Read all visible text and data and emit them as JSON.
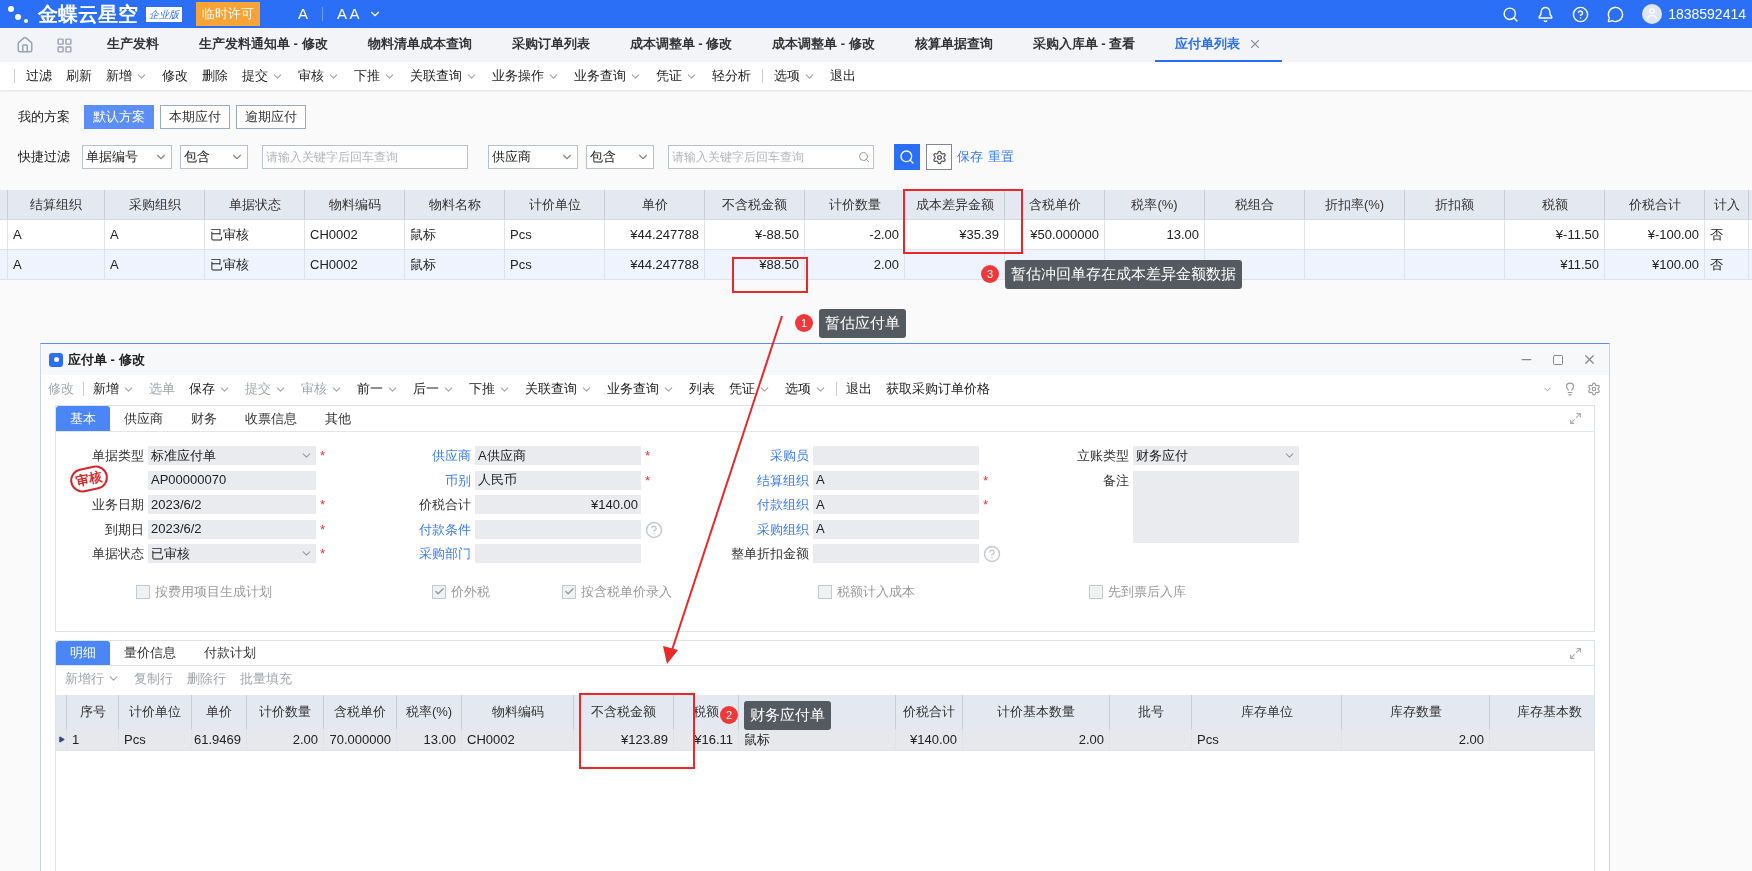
{
  "top_bar": {
    "logo_text": "金蝶云星空",
    "edition": "企业版",
    "license_badge": "临时许可",
    "font_small": "A",
    "font_large": "A A",
    "user": "1838592414"
  },
  "tabs": [
    {
      "label": "生产发料",
      "selected": false,
      "closable": false
    },
    {
      "label": "生产发料通知单 - 修改",
      "selected": false,
      "closable": false
    },
    {
      "label": "物料清单成本查询",
      "selected": false,
      "closable": false
    },
    {
      "label": "采购订单列表",
      "selected": false,
      "closable": false
    },
    {
      "label": "成本调整单 - 修改",
      "selected": false,
      "closable": false
    },
    {
      "label": "成本调整单 - 修改",
      "selected": false,
      "closable": false
    },
    {
      "label": "核算单据查询",
      "selected": false,
      "closable": false
    },
    {
      "label": "采购入库单 - 查看",
      "selected": false,
      "closable": false
    },
    {
      "label": "应付单列表",
      "selected": true,
      "closable": true
    }
  ],
  "toolbar": {
    "groups": [
      [
        {
          "label": "过滤",
          "menu": false
        },
        {
          "label": "刷新",
          "menu": false
        },
        {
          "label": "新增",
          "menu": true
        },
        {
          "label": "修改",
          "menu": false
        },
        {
          "label": "删除",
          "menu": false
        },
        {
          "label": "提交",
          "menu": true
        },
        {
          "label": "审核",
          "menu": true
        },
        {
          "label": "下推",
          "menu": true
        },
        {
          "label": "关联查询",
          "menu": true
        },
        {
          "label": "业务操作",
          "menu": true
        },
        {
          "label": "业务查询",
          "menu": true
        },
        {
          "label": "凭证",
          "menu": true
        },
        {
          "label": "轻分析",
          "menu": false
        }
      ],
      [
        {
          "label": "选项",
          "menu": true
        },
        {
          "label": "退出",
          "menu": false
        }
      ]
    ]
  },
  "filter": {
    "scheme_label": "我的方案",
    "schemes": [
      {
        "label": "默认方案",
        "selected": true
      },
      {
        "label": "本期应付",
        "selected": false
      },
      {
        "label": "逾期应付",
        "selected": false
      }
    ],
    "quick_label": "快捷过滤",
    "conditions": [
      {
        "field": "单据编号",
        "operator": "包含",
        "placeholder": "请输入关键字后回车查询"
      },
      {
        "field": "供应商",
        "operator": "包含",
        "placeholder": "请输入关键字后回车查询"
      }
    ],
    "links": [
      "保存",
      "重置"
    ]
  },
  "list_grid": {
    "columns": [
      {
        "label": "结算组织",
        "numeric": false
      },
      {
        "label": "采购组织",
        "numeric": false
      },
      {
        "label": "单据状态",
        "numeric": false
      },
      {
        "label": "物料编码",
        "numeric": false
      },
      {
        "label": "物料名称",
        "numeric": false
      },
      {
        "label": "计价单位",
        "numeric": false
      },
      {
        "label": "单价",
        "numeric": true
      },
      {
        "label": "不含税金额",
        "numeric": true
      },
      {
        "label": "计价数量",
        "numeric": true
      },
      {
        "label": "成本差异金额",
        "numeric": true
      },
      {
        "label": "含税单价",
        "numeric": true
      },
      {
        "label": "税率(%)",
        "numeric": true
      },
      {
        "label": "税组合"
      },
      {
        "label": "折扣率(%)"
      },
      {
        "label": "折扣额"
      },
      {
        "label": "税额",
        "numeric": true
      },
      {
        "label": "价税合计",
        "numeric": true
      },
      {
        "label": "计入",
        "numeric": false
      }
    ],
    "rows": [
      {
        "selected": false,
        "cells": [
          "A",
          "A",
          "已审核",
          "CH0002",
          "鼠标",
          "Pcs",
          "¥44.247788",
          "¥-88.50",
          "-2.00",
          "¥35.39",
          "¥50.000000",
          "13.00",
          null,
          null,
          null,
          "¥-11.50",
          "¥-100.00",
          "否"
        ]
      },
      {
        "selected": true,
        "cells": [
          "A",
          "A",
          "已审核",
          "CH0002",
          "鼠标",
          "Pcs",
          "¥44.247788",
          "¥88.50",
          "2.00",
          null,
          null,
          null,
          null,
          null,
          null,
          "¥11.50",
          "¥100.00",
          "否"
        ]
      }
    ]
  },
  "callouts": [
    {
      "number": "1",
      "text": "暂估应付单"
    },
    {
      "number": "2",
      "text": "财务应付单"
    },
    {
      "number": "3",
      "text": "暂估冲回单存在成本差异金额数据"
    }
  ],
  "dialog": {
    "title": "应付单 - 修改",
    "required_mark": "*",
    "toolbar": [
      [
        {
          "label": "修改",
          "menu": false,
          "disabled": true
        }
      ],
      [
        {
          "label": "新增",
          "menu": true,
          "disabled": false
        },
        {
          "label": "选单",
          "menu": false,
          "disabled": true
        },
        {
          "label": "保存",
          "menu": true,
          "disabled": false
        },
        {
          "label": "提交",
          "menu": true,
          "disabled": true
        },
        {
          "label": "审核",
          "menu": true,
          "disabled": true
        },
        {
          "label": "前一",
          "menu": true,
          "disabled": false
        },
        {
          "label": "后一",
          "menu": true,
          "disabled": false
        },
        {
          "label": "下推",
          "menu": true,
          "disabled": false
        },
        {
          "label": "关联查询",
          "menu": true,
          "disabled": false
        },
        {
          "label": "业务查询",
          "menu": true,
          "disabled": false
        },
        {
          "label": "列表",
          "menu": false,
          "disabled": false
        },
        {
          "label": "凭证",
          "menu": true,
          "disabled": false
        },
        {
          "label": "选项",
          "menu": true,
          "disabled": false
        }
      ],
      [
        {
          "label": "退出",
          "menu": false,
          "disabled": false
        },
        {
          "label": "获取采购订单价格",
          "menu": false,
          "disabled": false
        }
      ]
    ],
    "tabs": [
      {
        "label": "基本",
        "selected": true
      },
      {
        "label": "供应商",
        "selected": false
      },
      {
        "label": "财务",
        "selected": false
      },
      {
        "label": "收票信息",
        "selected": false
      },
      {
        "label": "其他",
        "selected": false
      }
    ],
    "form": [
      [
        {
          "label": "单据类型",
          "value": "标准应付单",
          "kind": "select",
          "link": false,
          "required": true,
          "help": false
        },
        {
          "stamp": "审核",
          "value": "AP00000070",
          "kind": "text",
          "required": false,
          "help": false
        },
        {
          "label": "业务日期",
          "value": "2023/6/2",
          "kind": "text",
          "link": false,
          "required": true,
          "help": false
        },
        {
          "label": "到期日",
          "value": "2023/6/2",
          "kind": "text",
          "link": false,
          "required": true,
          "help": false
        },
        {
          "label": "单据状态",
          "value": "已审核",
          "kind": "select",
          "link": false,
          "required": true,
          "help": false
        }
      ],
      [
        {
          "label": "供应商",
          "value": "A供应商",
          "kind": "text",
          "link": true,
          "required": true,
          "help": false
        },
        {
          "label": "币别",
          "value": "人民币",
          "kind": "text",
          "link": true,
          "required": true,
          "help": false
        },
        {
          "label": "价税合计",
          "value": "¥140.00",
          "kind": "amount",
          "link": false,
          "required": false,
          "help": false
        },
        {
          "label": "付款条件",
          "kind": "text",
          "link": true,
          "required": false,
          "help": true
        },
        {
          "label": "采购部门",
          "kind": "text",
          "link": true,
          "required": false,
          "help": false
        }
      ],
      [
        {
          "label": "采购员",
          "kind": "text",
          "link": true,
          "required": false,
          "help": false
        },
        {
          "label": "结算组织",
          "value": "A",
          "kind": "text",
          "link": true,
          "required": true,
          "help": false
        },
        {
          "label": "付款组织",
          "value": "A",
          "kind": "text",
          "link": true,
          "required": true,
          "help": false
        },
        {
          "label": "采购组织",
          "value": "A",
          "kind": "text",
          "link": true,
          "required": false,
          "help": false
        },
        {
          "label": "整单折扣金额",
          "kind": "text",
          "link": false,
          "required": false,
          "help": true
        }
      ],
      [
        {
          "label": "立账类型",
          "value": "财务应付",
          "kind": "select",
          "link": false,
          "required": false,
          "help": false
        },
        {
          "label": "备注",
          "kind": "textarea",
          "link": false,
          "required": false,
          "help": false
        }
      ]
    ],
    "checkboxes": [
      {
        "label": "按费用项目生成计划",
        "checked": false,
        "disabled": true
      },
      {
        "label": "价外税",
        "checked": true,
        "disabled": true
      },
      {
        "label": "按含税单价录入",
        "checked": true,
        "disabled": true
      },
      {
        "label": "税额计入成本",
        "checked": false,
        "disabled": true
      },
      {
        "label": "先到票后入库",
        "checked": false,
        "disabled": true
      }
    ],
    "detail_tabs": [
      {
        "label": "明细",
        "selected": true
      },
      {
        "label": "量价信息",
        "selected": false
      },
      {
        "label": "付款计划",
        "selected": false
      }
    ],
    "detail_toolbar": [
      {
        "label": "新增行",
        "menu": true,
        "disabled": true
      },
      {
        "label": "复制行",
        "menu": false,
        "disabled": true
      },
      {
        "label": "删除行",
        "menu": false,
        "disabled": true
      },
      {
        "label": "批量填充",
        "menu": false,
        "disabled": true
      }
    ],
    "detail_grid": {
      "columns": [
        {
          "label": "序号",
          "numeric": false
        },
        {
          "label": "计价单位",
          "numeric": false
        },
        {
          "label": "单价",
          "numeric": true
        },
        {
          "label": "计价数量",
          "numeric": true
        },
        {
          "label": "含税单价",
          "numeric": true
        },
        {
          "label": "税率(%)",
          "numeric": true
        },
        {
          "label": "物料编码",
          "numeric": false
        },
        {
          "label": "不含税金额",
          "numeric": true
        },
        {
          "label": "税额",
          "numeric": true
        },
        {
          "numeric": false
        },
        {
          "label": "价税合计",
          "numeric": true
        },
        {
          "label": "计价基本数量",
          "numeric": true
        },
        {
          "label": "批号"
        },
        {
          "label": "库存单位",
          "numeric": false
        },
        {
          "label": "库存数量",
          "numeric": true
        },
        {
          "label": "库存基本数"
        }
      ],
      "rows": [
        {
          "selected": true,
          "cells": [
            "1",
            "Pcs",
            "61.9469",
            "2.00",
            "70.000000",
            "13.00",
            "CH0002",
            "¥123.89",
            "¥16.11",
            "鼠标",
            "¥140.00",
            "2.00",
            null,
            "Pcs",
            "2.00",
            null
          ]
        }
      ]
    }
  }
}
